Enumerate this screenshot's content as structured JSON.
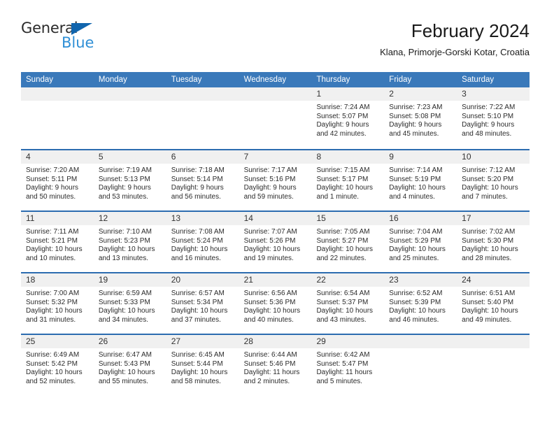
{
  "brand": {
    "name_part1": "General",
    "name_part2": "Blue"
  },
  "header": {
    "title": "February 2024",
    "subtitle": "Klana, Primorje-Gorski Kotar, Croatia"
  },
  "calendar": {
    "weekday_headers": [
      "Sunday",
      "Monday",
      "Tuesday",
      "Wednesday",
      "Thursday",
      "Friday",
      "Saturday"
    ],
    "colors": {
      "header_blue": "#3a79ba",
      "row_divider_blue": "#2c6cb0",
      "daynum_band": "#f0f0f0",
      "brand_blue": "#2f8fd6",
      "brand_triangle": "#1165ad"
    },
    "weeks": [
      [
        {
          "day": "",
          "sunrise": "",
          "sunset": "",
          "daylight": ""
        },
        {
          "day": "",
          "sunrise": "",
          "sunset": "",
          "daylight": ""
        },
        {
          "day": "",
          "sunrise": "",
          "sunset": "",
          "daylight": ""
        },
        {
          "day": "",
          "sunrise": "",
          "sunset": "",
          "daylight": ""
        },
        {
          "day": "1",
          "sunrise": "Sunrise: 7:24 AM",
          "sunset": "Sunset: 5:07 PM",
          "daylight": "Daylight: 9 hours and 42 minutes."
        },
        {
          "day": "2",
          "sunrise": "Sunrise: 7:23 AM",
          "sunset": "Sunset: 5:08 PM",
          "daylight": "Daylight: 9 hours and 45 minutes."
        },
        {
          "day": "3",
          "sunrise": "Sunrise: 7:22 AM",
          "sunset": "Sunset: 5:10 PM",
          "daylight": "Daylight: 9 hours and 48 minutes."
        }
      ],
      [
        {
          "day": "4",
          "sunrise": "Sunrise: 7:20 AM",
          "sunset": "Sunset: 5:11 PM",
          "daylight": "Daylight: 9 hours and 50 minutes."
        },
        {
          "day": "5",
          "sunrise": "Sunrise: 7:19 AM",
          "sunset": "Sunset: 5:13 PM",
          "daylight": "Daylight: 9 hours and 53 minutes."
        },
        {
          "day": "6",
          "sunrise": "Sunrise: 7:18 AM",
          "sunset": "Sunset: 5:14 PM",
          "daylight": "Daylight: 9 hours and 56 minutes."
        },
        {
          "day": "7",
          "sunrise": "Sunrise: 7:17 AM",
          "sunset": "Sunset: 5:16 PM",
          "daylight": "Daylight: 9 hours and 59 minutes."
        },
        {
          "day": "8",
          "sunrise": "Sunrise: 7:15 AM",
          "sunset": "Sunset: 5:17 PM",
          "daylight": "Daylight: 10 hours and 1 minute."
        },
        {
          "day": "9",
          "sunrise": "Sunrise: 7:14 AM",
          "sunset": "Sunset: 5:19 PM",
          "daylight": "Daylight: 10 hours and 4 minutes."
        },
        {
          "day": "10",
          "sunrise": "Sunrise: 7:12 AM",
          "sunset": "Sunset: 5:20 PM",
          "daylight": "Daylight: 10 hours and 7 minutes."
        }
      ],
      [
        {
          "day": "11",
          "sunrise": "Sunrise: 7:11 AM",
          "sunset": "Sunset: 5:21 PM",
          "daylight": "Daylight: 10 hours and 10 minutes."
        },
        {
          "day": "12",
          "sunrise": "Sunrise: 7:10 AM",
          "sunset": "Sunset: 5:23 PM",
          "daylight": "Daylight: 10 hours and 13 minutes."
        },
        {
          "day": "13",
          "sunrise": "Sunrise: 7:08 AM",
          "sunset": "Sunset: 5:24 PM",
          "daylight": "Daylight: 10 hours and 16 minutes."
        },
        {
          "day": "14",
          "sunrise": "Sunrise: 7:07 AM",
          "sunset": "Sunset: 5:26 PM",
          "daylight": "Daylight: 10 hours and 19 minutes."
        },
        {
          "day": "15",
          "sunrise": "Sunrise: 7:05 AM",
          "sunset": "Sunset: 5:27 PM",
          "daylight": "Daylight: 10 hours and 22 minutes."
        },
        {
          "day": "16",
          "sunrise": "Sunrise: 7:04 AM",
          "sunset": "Sunset: 5:29 PM",
          "daylight": "Daylight: 10 hours and 25 minutes."
        },
        {
          "day": "17",
          "sunrise": "Sunrise: 7:02 AM",
          "sunset": "Sunset: 5:30 PM",
          "daylight": "Daylight: 10 hours and 28 minutes."
        }
      ],
      [
        {
          "day": "18",
          "sunrise": "Sunrise: 7:00 AM",
          "sunset": "Sunset: 5:32 PM",
          "daylight": "Daylight: 10 hours and 31 minutes."
        },
        {
          "day": "19",
          "sunrise": "Sunrise: 6:59 AM",
          "sunset": "Sunset: 5:33 PM",
          "daylight": "Daylight: 10 hours and 34 minutes."
        },
        {
          "day": "20",
          "sunrise": "Sunrise: 6:57 AM",
          "sunset": "Sunset: 5:34 PM",
          "daylight": "Daylight: 10 hours and 37 minutes."
        },
        {
          "day": "21",
          "sunrise": "Sunrise: 6:56 AM",
          "sunset": "Sunset: 5:36 PM",
          "daylight": "Daylight: 10 hours and 40 minutes."
        },
        {
          "day": "22",
          "sunrise": "Sunrise: 6:54 AM",
          "sunset": "Sunset: 5:37 PM",
          "daylight": "Daylight: 10 hours and 43 minutes."
        },
        {
          "day": "23",
          "sunrise": "Sunrise: 6:52 AM",
          "sunset": "Sunset: 5:39 PM",
          "daylight": "Daylight: 10 hours and 46 minutes."
        },
        {
          "day": "24",
          "sunrise": "Sunrise: 6:51 AM",
          "sunset": "Sunset: 5:40 PM",
          "daylight": "Daylight: 10 hours and 49 minutes."
        }
      ],
      [
        {
          "day": "25",
          "sunrise": "Sunrise: 6:49 AM",
          "sunset": "Sunset: 5:42 PM",
          "daylight": "Daylight: 10 hours and 52 minutes."
        },
        {
          "day": "26",
          "sunrise": "Sunrise: 6:47 AM",
          "sunset": "Sunset: 5:43 PM",
          "daylight": "Daylight: 10 hours and 55 minutes."
        },
        {
          "day": "27",
          "sunrise": "Sunrise: 6:45 AM",
          "sunset": "Sunset: 5:44 PM",
          "daylight": "Daylight: 10 hours and 58 minutes."
        },
        {
          "day": "28",
          "sunrise": "Sunrise: 6:44 AM",
          "sunset": "Sunset: 5:46 PM",
          "daylight": "Daylight: 11 hours and 2 minutes."
        },
        {
          "day": "29",
          "sunrise": "Sunrise: 6:42 AM",
          "sunset": "Sunset: 5:47 PM",
          "daylight": "Daylight: 11 hours and 5 minutes."
        },
        {
          "day": "",
          "sunrise": "",
          "sunset": "",
          "daylight": ""
        },
        {
          "day": "",
          "sunrise": "",
          "sunset": "",
          "daylight": ""
        }
      ]
    ]
  }
}
